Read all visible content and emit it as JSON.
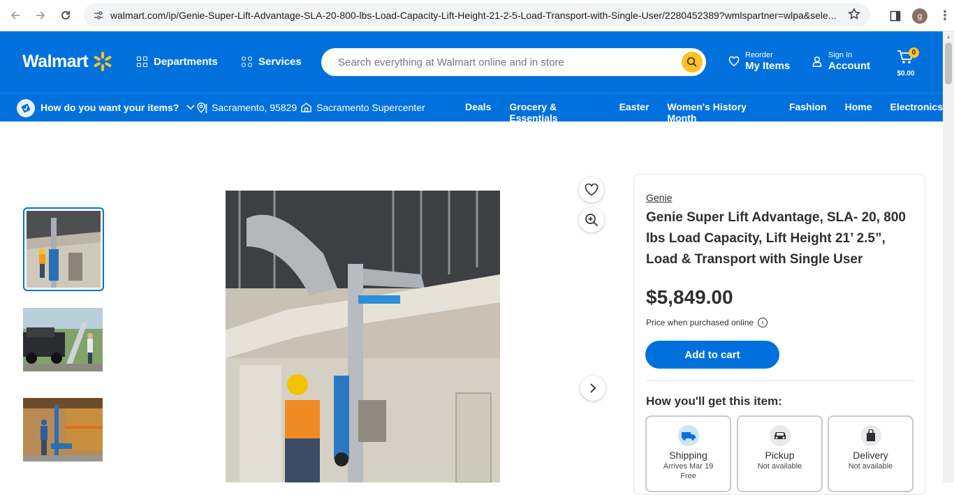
{
  "browser": {
    "url": "walmart.com/ip/Genie-Super-Lift-Advantage-SLA-20-800-lbs-Load-Capacity-Lift-Height-21-2-5-Load-Transport-with-Single-User/2280452389?wmlspartner=wlpa&sele...",
    "profile_initial": "g"
  },
  "header": {
    "logo_text": "Walmart",
    "departments": "Departments",
    "services": "Services",
    "search_placeholder": "Search everything at Walmart online and in store",
    "reorder_small": "Reorder",
    "reorder_big": "My Items",
    "signin_small": "Sign In",
    "signin_big": "Account",
    "cart_count": "0",
    "cart_total": "$0.00"
  },
  "subnav": {
    "fulfillment_prompt": "How do you want your items?",
    "location": "Sacramento, 95829",
    "store": "Sacramento Supercenter",
    "links": [
      "Deals",
      "Grocery & Essentials",
      "Easter",
      "Women's History Month",
      "Fashion",
      "Home",
      "Electronics"
    ]
  },
  "product": {
    "brand": "Genie",
    "title": "Genie Super Lift Advantage, SLA- 20, 800 lbs Load Capacity, Lift Height 21’ 2.5”, Load & Transport with Single User",
    "price": "$5,849.00",
    "price_note": "Price when purchased online",
    "add_to_cart": "Add to cart",
    "how_get": "How you'll get this item:",
    "options": [
      {
        "label": "Shipping",
        "sub": "Arrives Mar 19",
        "sub2": "Free"
      },
      {
        "label": "Pickup",
        "sub": "Not available",
        "sub2": ""
      },
      {
        "label": "Delivery",
        "sub": "Not available",
        "sub2": ""
      }
    ]
  },
  "colors": {
    "brand_blue": "#0071dc",
    "spark_yellow": "#ffc220"
  }
}
